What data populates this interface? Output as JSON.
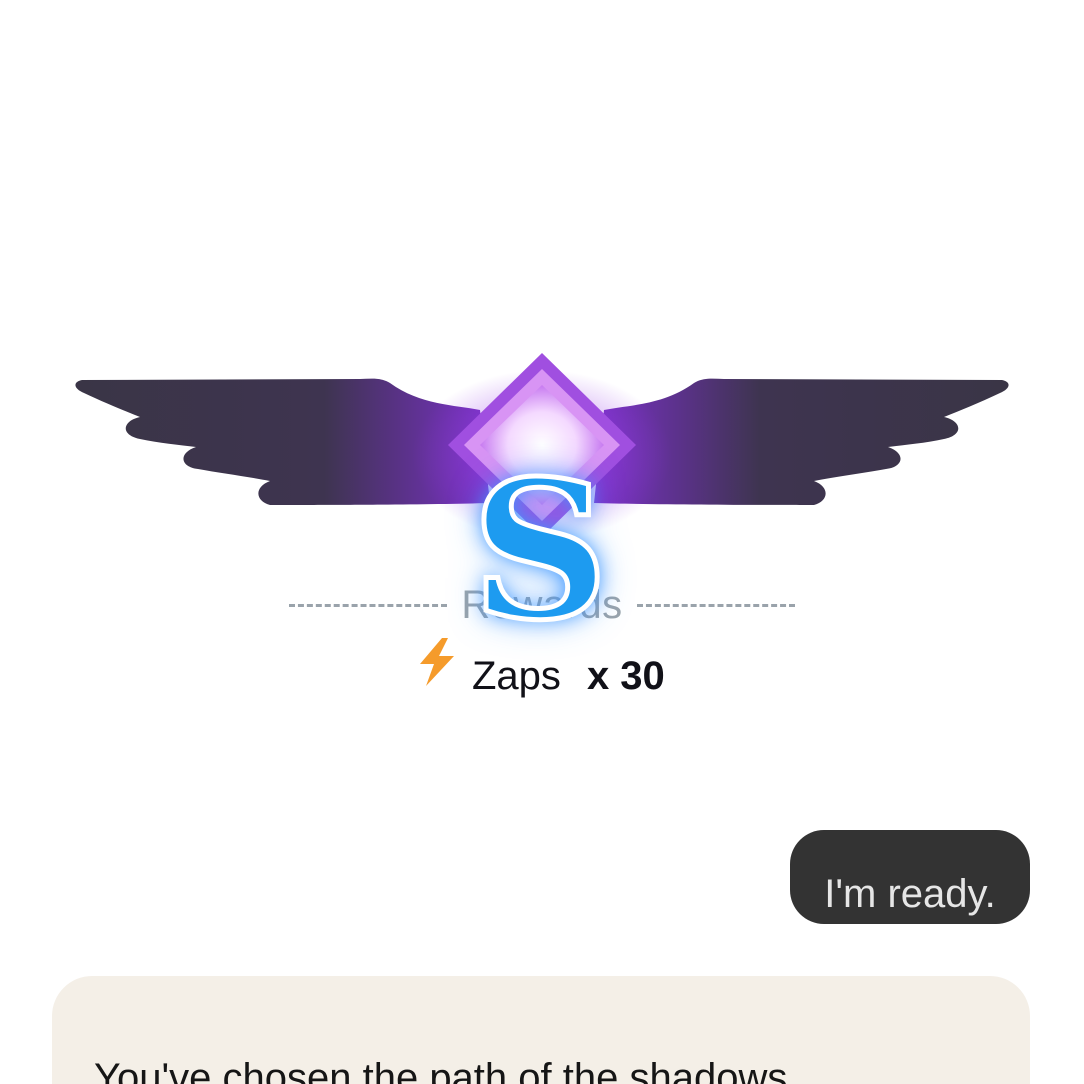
{
  "badge": {
    "grade": "S",
    "colors": {
      "wing": "#3b3548",
      "wing_glow": "#7b2fd0",
      "gem": "#c77af0",
      "grade": "#1d9bf0"
    }
  },
  "rewards": {
    "title": "Rewards",
    "items": [
      {
        "icon": "lightning-bolt-icon",
        "name": "Zaps",
        "count": "x 30"
      }
    ]
  },
  "reply_chip": {
    "label": "I'm ready."
  },
  "story": {
    "text": "You've chosen the path of the shadows"
  },
  "colors": {
    "chip_bg": "#333333",
    "card_bg": "#f4efe7",
    "zap": "#f59b2b"
  }
}
